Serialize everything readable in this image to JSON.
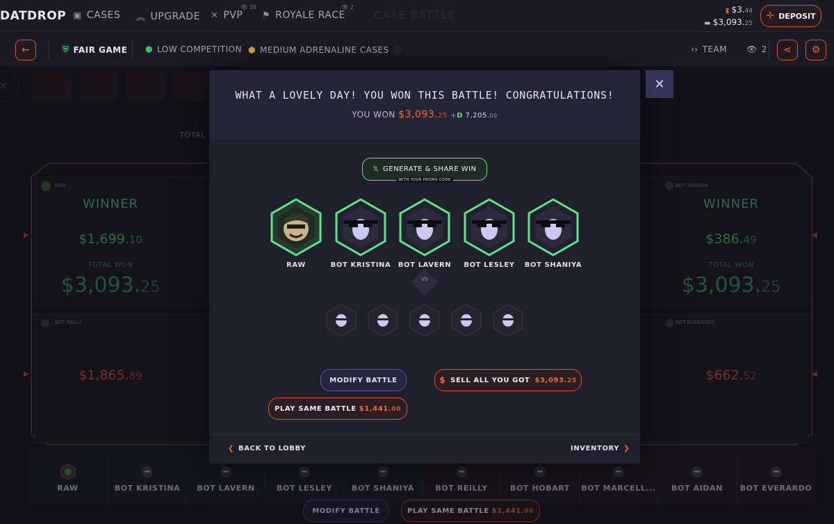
{
  "topnav": {
    "logo": "DATDROP",
    "items": [
      {
        "label": "CASES",
        "icon": "cases-icon"
      },
      {
        "label": "UPGRADE",
        "icon": "upgrade-icon"
      },
      {
        "label": "PVP",
        "icon": "pvp-icon",
        "badge": "35"
      },
      {
        "label": "ROYALE RACE",
        "icon": "flag-icon",
        "badge": "2"
      }
    ],
    "faded_title": "CASE BATTLE",
    "balance_cash_main": "$3.",
    "balance_cash_dec": "44",
    "balance_gun_main": "$3,093.",
    "balance_gun_dec": "25",
    "deposit_label": "DEPOSIT"
  },
  "battlebar": {
    "fair_game": "FAIR GAME",
    "competition": "LOW COMPETITION",
    "adrenaline": "MEDIUM ADRENALINE CASES",
    "team": "TEAM",
    "viewers": "2"
  },
  "background": {
    "total_cost_label": "TOTAL C",
    "left_top": {
      "player": "RAW",
      "status": "WINNER",
      "value_main": "$1,699.",
      "value_dec": "10",
      "total_label": "TOTAL WON",
      "total_main": "$3,093.",
      "total_dec": "25"
    },
    "left_bottom": {
      "player": "BOT REILLY",
      "value_main": "$1,865.",
      "value_dec": "89"
    },
    "right_top": {
      "player": "BOT SHANIYA",
      "status": "WINNER",
      "value_main": "$386.",
      "value_dec": "49",
      "total_label": "TOTAL WON",
      "total_main": "$3,093.",
      "total_dec": "25"
    },
    "right_bottom": {
      "player": "BOT EVERARDO",
      "value_main": "$662.",
      "value_dec": "52"
    }
  },
  "modal": {
    "title": "WHAT A LOVELY DAY! YOU WON THIS BATTLE! CONGRATULATIONS!",
    "you_won_label": "YOU WON",
    "won_main": "$3,093.",
    "won_dec": "25",
    "points_prefix": "+",
    "points_main": "7,205.",
    "points_dec": "00",
    "share_label": "GENERATE & SHARE WIN",
    "share_sub": "WITH YOUR PROMO CODE",
    "winners": [
      "RAW",
      "BOT KRISTINA",
      "BOT LAVERN",
      "BOT LESLEY",
      "BOT SHANIYA"
    ],
    "vs_label": "VS",
    "modify_label": "MODIFY BATTLE",
    "sell_label": "SELL ALL YOU GOT",
    "sell_main": "$3,093.",
    "sell_dec": "25",
    "play_label": "PLAY SAME BATTLE",
    "play_main": "$1,441.",
    "play_dec": "00",
    "back_label": "BACK TO LOBBY",
    "inventory_label": "INVENTORY"
  },
  "bottom": {
    "players": [
      "RAW",
      "BOT KRISTINA",
      "BOT LAVERN",
      "BOT LESLEY",
      "BOT SHANIYA",
      "BOT REILLY",
      "BOT HOBART",
      "BOT MARCELL...",
      "BOT AIDAN",
      "BOT EVERARDO"
    ],
    "modify_label": "MODIFY BATTLE",
    "play_label": "PLAY SAME BATTLE",
    "play_main": "$1,441.",
    "play_dec": "00"
  },
  "colors": {
    "accent": "#e2562f",
    "green": "#5be58a",
    "winner_green": "#4fb878",
    "loser_red": "#d9483f",
    "purple": "#5b55a6"
  }
}
